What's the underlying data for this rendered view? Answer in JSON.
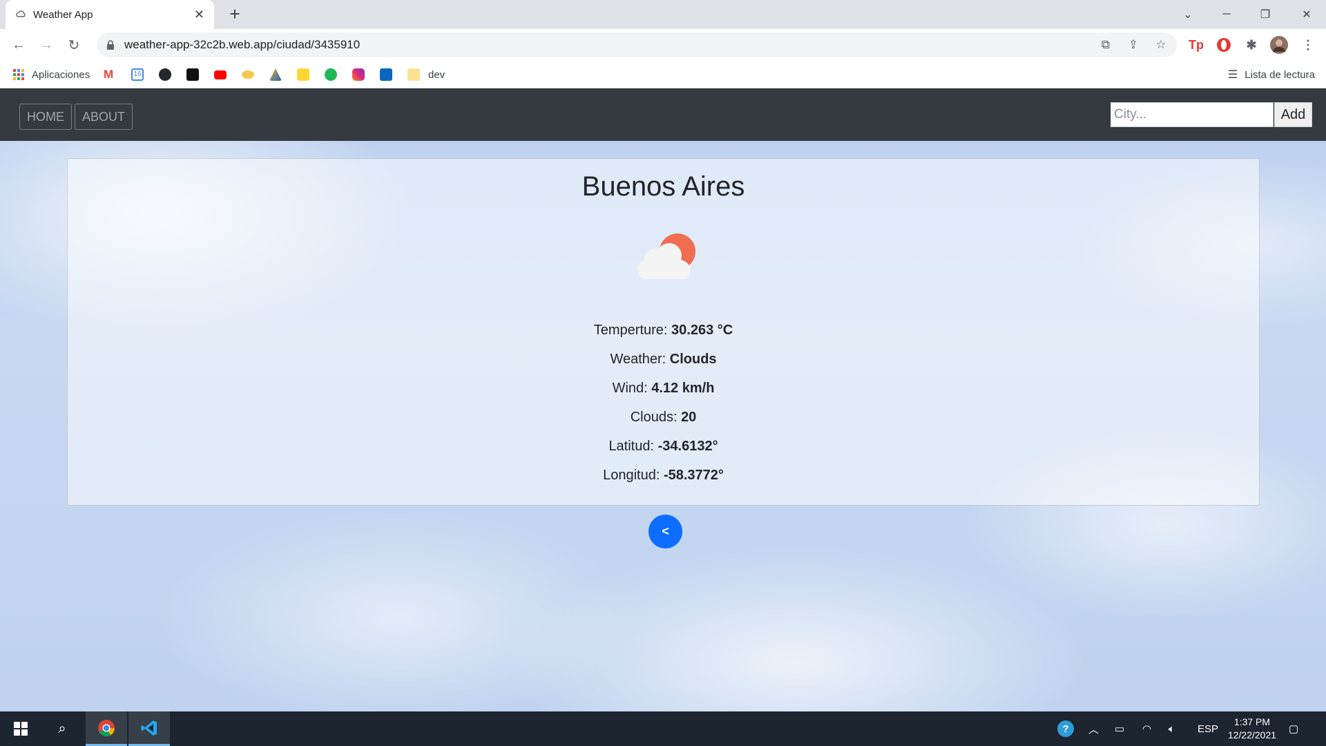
{
  "browser": {
    "tab_title": "Weather App",
    "url": "weather-app-32c2b.web.app/ciudad/3435910",
    "bookmarks": {
      "apps_label": "Aplicaciones",
      "folder_label": "dev",
      "calendar_day": "16"
    },
    "reading_list_label": "Lista de lectura"
  },
  "nav": {
    "home_label": "HOME",
    "about_label": "ABOUT",
    "search_placeholder": "City...",
    "add_label": "Add"
  },
  "city": {
    "name": "Buenos Aires",
    "icon": "cloud-sun-icon",
    "temperature": {
      "label": "Temperture:",
      "value": "30.263 °C"
    },
    "weather": {
      "label": "Weather:",
      "value": "Clouds"
    },
    "wind": {
      "label": "Wind:",
      "value": "4.12 km/h"
    },
    "clouds": {
      "label": "Clouds:",
      "value": "20"
    },
    "latitude": {
      "label": "Latitud:",
      "value": "-34.6132°"
    },
    "longitude": {
      "label": "Longitud:",
      "value": "-58.3772°"
    }
  },
  "back_button_label": "<",
  "taskbar": {
    "language": "ESP",
    "time": "1:37 PM",
    "date": "12/22/2021"
  },
  "colors": {
    "navbar": "#343a40",
    "back_button": "#0d6efd",
    "sun": "#ee6e4f"
  }
}
